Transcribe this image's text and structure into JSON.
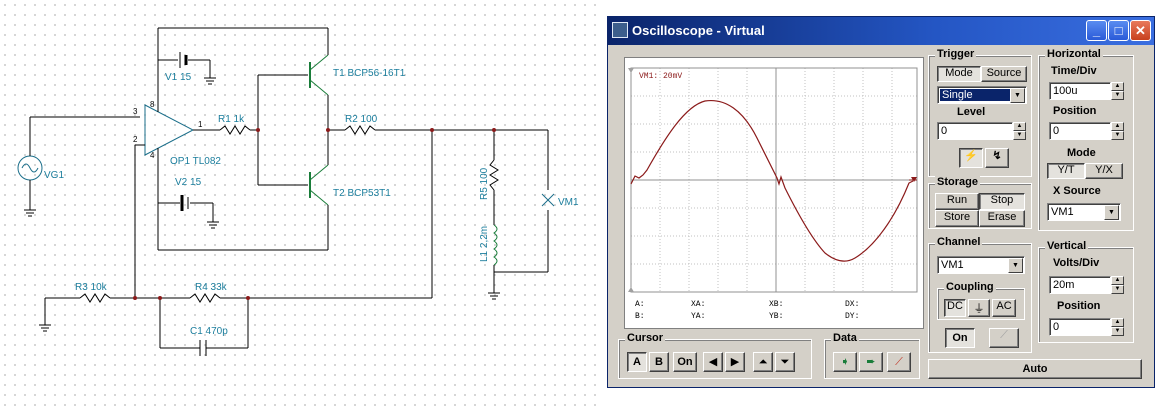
{
  "schematic": {
    "labels": {
      "vg1": "VG1",
      "v1": "V1 15",
      "v2": "V2 15",
      "op1": "OP1 TL082",
      "r1": "R1 1k",
      "r2": "R2 100",
      "r3": "R3 10k",
      "r4": "R4 33k",
      "r5": "R5 100",
      "l1": "L1 2,2m",
      "c1": "C1 470p",
      "t1": "T1 BCP56-16T1",
      "t2": "T2 BCP53T1",
      "vm1": "VM1",
      "pin3": "3",
      "pin2": "2",
      "pin1": "1",
      "pin8": "8",
      "pin4": "4"
    }
  },
  "oscilloscope": {
    "title": "Oscilloscope - Virtual",
    "screen_label": "VM1: 20mV",
    "readouts": {
      "a": "A:",
      "b": "B:",
      "xa": "XA:",
      "ya": "YA:",
      "xb": "XB:",
      "yb": "YB:",
      "dx": "DX:",
      "dy": "DY:"
    },
    "trigger": {
      "title": "Trigger",
      "mode_label": "Mode",
      "source_label": "Source",
      "mode_value": "Single",
      "level_label": "Level",
      "level_value": "0"
    },
    "horizontal": {
      "title": "Horizontal",
      "timediv_label": "Time/Div",
      "timediv_value": "100u",
      "position_label": "Position",
      "position_value": "0",
      "mode_label": "Mode",
      "yt_label": "Y/T",
      "yx_label": "Y/X",
      "xsource_label": "X Source",
      "xsource_value": "VM1"
    },
    "storage": {
      "title": "Storage",
      "run": "Run",
      "stop": "Stop",
      "store": "Store",
      "erase": "Erase"
    },
    "channel": {
      "title": "Channel",
      "value": "VM1",
      "coupling_title": "Coupling",
      "dc": "DC",
      "ac": "AC",
      "on": "On"
    },
    "vertical": {
      "title": "Vertical",
      "voltsdiv_label": "Volts/Div",
      "voltsdiv_value": "20m",
      "position_label": "Position",
      "position_value": "0"
    },
    "cursor": {
      "title": "Cursor",
      "a": "A",
      "b": "B",
      "on": "On"
    },
    "data_title": "Data",
    "auto": "Auto",
    "trace_color": "#8b1a1a",
    "icons": [
      "minimize-icon",
      "maximize-icon",
      "close-icon",
      "falling-edge-icon",
      "rising-edge-icon",
      "ground-icon",
      "probe-icon"
    ]
  }
}
